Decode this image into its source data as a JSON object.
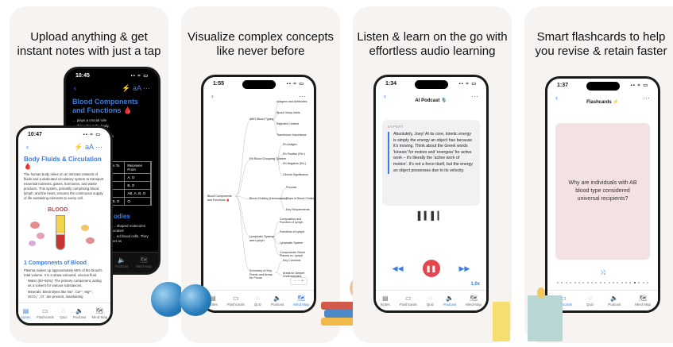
{
  "cards": [
    {
      "headline": "Upload anything & get instant notes with just a tap",
      "back_phone": {
        "time": "10:45",
        "title": "Blood Components and Functions 🩸",
        "lines": [
          "… plays a crucial role",
          "… throughout the body,",
          "… ns, and maintaining",
          "… of these components is",
          "… human physiology."
        ],
        "mid_lines": [
          "… ) and B antigens",
          "… BO blood groups:"
        ],
        "table": {
          "headers": [
            "",
            "Donates To",
            "Receives From"
          ],
          "rows": [
            [
              "",
              "A, AB",
              "A, O"
            ],
            [
              "",
              "B, AB",
              "B, O"
            ],
            [
              "AB",
              "AB",
              "AB, A, B, O"
            ],
            [
              "",
              "A, B, AB, O",
              "O"
            ]
          ]
        },
        "subheading": "odies",
        "tail_lines": [
          "… shaped molecules located",
          "… ed blood cells. They act as"
        ],
        "tabs": [
          "Podcast",
          "Mind Map"
        ]
      },
      "front_phone": {
        "time": "10:47",
        "title": "Body Fluids & Circulation 🩸",
        "intro": "The human body relies on an intricate network of fluids and a dedicated circulatory system to transport essential nutrients, gases, hormones, and waste products. This system, primarily comprising blood, lymph, and the heart, ensures the continuous supply of life-sustaining elements to every cell.",
        "illustration_word": "BLOOD",
        "section": "1 Components of Blood",
        "plasma_text": "Plasma makes up approximately 55% of the blood's total volume. It is a straw-coloured, viscous fluid.",
        "bullet_water": "Water (90–92%): The primary component, acting as a solvent for various substances.",
        "bullet_minerals": "Minerals: Electrolytes like Na⁺, Ca²⁺, Mg²⁺, HCO₃⁻, Cl⁻ are present, maintaining",
        "tabs": [
          "Notes",
          "Flashcards",
          "Quiz",
          "Podcast",
          "Mind Map"
        ]
      }
    },
    {
      "headline": "Visualize complex concepts like never before",
      "phone": {
        "time": "1:55",
        "root": "Blood Components and Functions 🩸",
        "branches": [
          {
            "label": "ABO Blood Types",
            "children": [
              "Antigens and Antibodies",
              "Blood Group Islets",
              "Rejected Content",
              "Transfusion Importance"
            ]
          },
          {
            "label": "Rh Blood Grouping System",
            "children": [
              "Rh Antigen",
              "Rh Positive (Rh+)",
              "Rh Negative (Rh-)",
              "Clinical Significance"
            ]
          },
          {
            "label": "Blood Clotting (Hemostasis)",
            "children": [
              "Purpose",
              "Steps of Blood Clotting",
              "Key Requirements"
            ]
          },
          {
            "label": "Lymphatic System and Lymph",
            "children": [
              "Composition and Function of Lymph",
              "Functions of Lymph",
              "Lymphatic System",
              "Components: Blood Plasma vs. Lymph"
            ]
          },
          {
            "label": "Summary of Key Points and Areas for Focus",
            "children": [
              "Key Concepts",
              "Areas for Deeper Understanding"
            ]
          }
        ],
        "zoom": "− ·· +",
        "tabs": [
          "Notes",
          "Flashcards",
          "Quiz",
          "Podcast",
          "Mind Map"
        ]
      }
    },
    {
      "headline": "Listen & learn on the go with effortless audio learning",
      "phone": {
        "time": "1:34",
        "title": "AI Podcast 🎙️",
        "speaker": "EXPERT",
        "quote": "Absolutely, Joey! At its core, kinetic energy is simply the energy an object has because it's moving. Think about the Greek words 'kinesis' for motion and 'energeia' for active work – it's literally the 'active work of motion'. It's not a force itself, but the energy an object possesses due to its velocity.",
        "speed": "1.0x",
        "tabs": [
          "Notes",
          "Flashcards",
          "Quiz",
          "Podcast",
          "Mind Map"
        ]
      }
    },
    {
      "headline": "Smart flashcards to help you revise & retain faster",
      "phone": {
        "time": "1:37",
        "title": "Flashcards ⚡",
        "question": "Why are individuals with AB blood type considered universal recipients?",
        "tabs": [
          "Flashcards",
          "Quiz",
          "Podcast",
          "Mind Map"
        ]
      }
    }
  ],
  "colors": {
    "accent": "#3b7ddd",
    "play": "#e5454f",
    "card_bg": "#f6f3f1",
    "flashcard": "#f4e2e2"
  }
}
